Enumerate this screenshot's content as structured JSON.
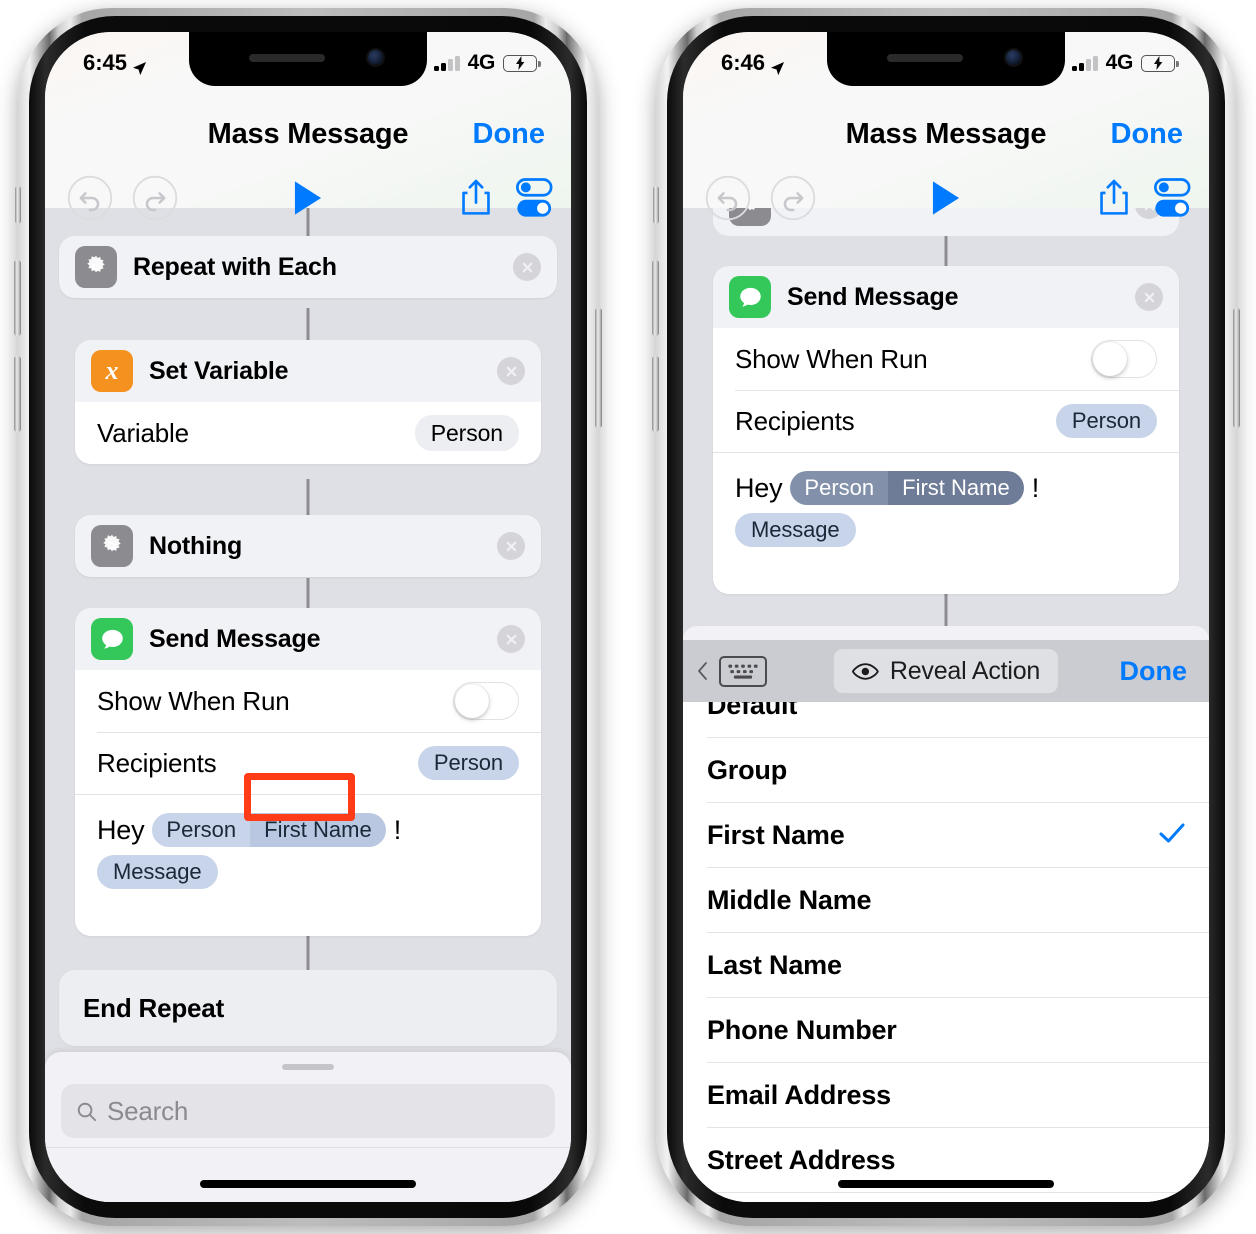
{
  "phones": [
    {
      "id": "phone-left",
      "status": {
        "time": "6:45",
        "network": "4G",
        "location_icon": "location-arrow-icon",
        "signal_bars_filled": 2,
        "signal_bars_total": 4,
        "battery_state": "charging"
      },
      "nav": {
        "title": "Mass Message",
        "done_label": "Done"
      },
      "toolbar": {
        "undo": "undo-icon",
        "redo": "redo-icon",
        "play": "play-icon",
        "share": "share-icon",
        "settings": "settings-sliders-icon"
      },
      "actions": [
        {
          "name": "Repeat with Each",
          "icon": "gear-icon"
        },
        {
          "name": "Set Variable",
          "icon": "variable-x-icon",
          "rows": [
            {
              "label": "Variable",
              "value": "Person"
            }
          ]
        },
        {
          "name": "Nothing",
          "icon": "gear-icon"
        },
        {
          "name": "Send Message",
          "icon": "messages-icon",
          "rows": [
            {
              "label": "Show When Run",
              "toggle": "off"
            },
            {
              "label": "Recipients",
              "value": "Person"
            }
          ],
          "message_line": {
            "prefix": "Hey",
            "token_person": "Person",
            "token_field": "First Name",
            "punctuation": "!",
            "token_message": "Message"
          }
        }
      ],
      "end_repeat": "End Repeat",
      "search": {
        "placeholder": "Search",
        "icon": "search-icon"
      },
      "highlight": {
        "target": "First Name",
        "color": "#ff3b18"
      }
    },
    {
      "id": "phone-right",
      "status": {
        "time": "6:46",
        "network": "4G",
        "location_icon": "location-arrow-icon",
        "signal_bars_filled": 2,
        "signal_bars_total": 4,
        "battery_state": "charging"
      },
      "nav": {
        "title": "Mass Message",
        "done_label": "Done"
      },
      "toolbar": {
        "undo": "undo-icon",
        "redo": "redo-icon",
        "play": "play-icon",
        "share": "share-icon",
        "settings": "settings-sliders-icon"
      },
      "actions": [
        {
          "name": "Send Message",
          "icon": "messages-icon",
          "rows": [
            {
              "label": "Show When Run",
              "toggle": "off"
            },
            {
              "label": "Recipients",
              "value": "Person"
            }
          ],
          "message_line": {
            "prefix": "Hey",
            "token_person": "Person",
            "token_field": "First Name",
            "punctuation": "!",
            "token_message": "Message"
          }
        }
      ],
      "keyboard_toolbar": {
        "keyboard_icon": "keyboard-icon",
        "back_chevron": "chevron-left-icon",
        "reveal_label": "Reveal Action",
        "reveal_icon": "eye-icon",
        "done_label": "Done"
      },
      "options": [
        {
          "label": "Default",
          "selected": false,
          "partial": true
        },
        {
          "label": "Group",
          "selected": false
        },
        {
          "label": "First Name",
          "selected": true
        },
        {
          "label": "Middle Name",
          "selected": false
        },
        {
          "label": "Last Name",
          "selected": false
        },
        {
          "label": "Phone Number",
          "selected": false
        },
        {
          "label": "Email Address",
          "selected": false
        },
        {
          "label": "Street Address",
          "selected": false
        }
      ]
    }
  ],
  "colors": {
    "accent_blue": "#007aff",
    "green_app": "#34c759",
    "orange_app": "#f5911e",
    "gray_app": "#8b8b90",
    "pill_blue": "#c8d4ea",
    "pill_selected": "#7e8ba6",
    "highlight_red": "#ff3b18",
    "canvas": "#dfe0e5"
  }
}
